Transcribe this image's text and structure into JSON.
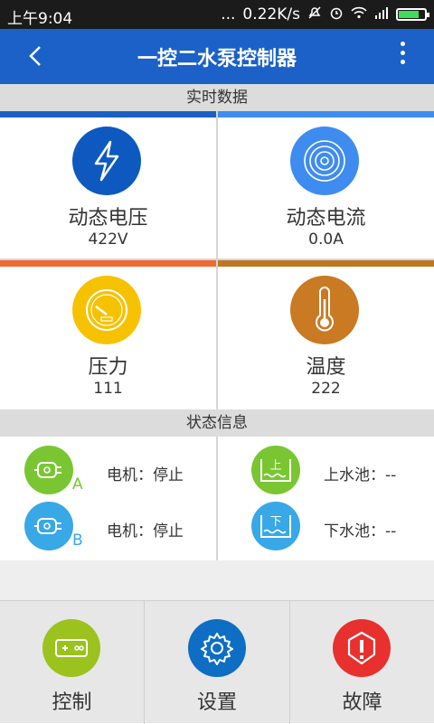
{
  "status_bar": {
    "time": "上午9:04",
    "network_speed": "0.22K/s",
    "dots": "...",
    "battery_level": 0.8
  },
  "title_bar": {
    "title": "一控二水泵控制器"
  },
  "realtime": {
    "header": "实时数据",
    "metrics": [
      {
        "name": "动态电压",
        "value": "422V",
        "bar_color": "#1a5fc4",
        "circle_color": "#0d59bf",
        "icon": "lightning-icon"
      },
      {
        "name": "动态电流",
        "value": "0.0A",
        "bar_color": "#3f8cf0",
        "circle_color": "#3f8cf0",
        "icon": "concentric-circles-icon"
      },
      {
        "name": "压力",
        "value": "111",
        "bar_color": "#f26a33",
        "circle_color": "#f6c200",
        "icon": "pressure-gauge-icon"
      },
      {
        "name": "温度",
        "value": "222",
        "bar_color": "#c07522",
        "circle_color": "#c97a22",
        "icon": "thermometer-icon"
      }
    ]
  },
  "status_info": {
    "header": "状态信息",
    "motors": [
      {
        "letter": "A",
        "text": "电机：停止",
        "color": "#79c632"
      },
      {
        "letter": "B",
        "text": "电机：停止",
        "color": "#38a8e7"
      }
    ],
    "pools": [
      {
        "icon_char": "上",
        "text": "上水池：--",
        "color": "#79c632"
      },
      {
        "icon_char": "下",
        "text": "下水池：--",
        "color": "#38a8e7"
      }
    ]
  },
  "bottom_nav": [
    {
      "label": "控制",
      "color": "#9cc21d",
      "icon": "gamepad-icon"
    },
    {
      "label": "设置",
      "color": "#0d6ec4",
      "icon": "gear-icon"
    },
    {
      "label": "故障",
      "color": "#e8302f",
      "icon": "warning-icon"
    }
  ]
}
